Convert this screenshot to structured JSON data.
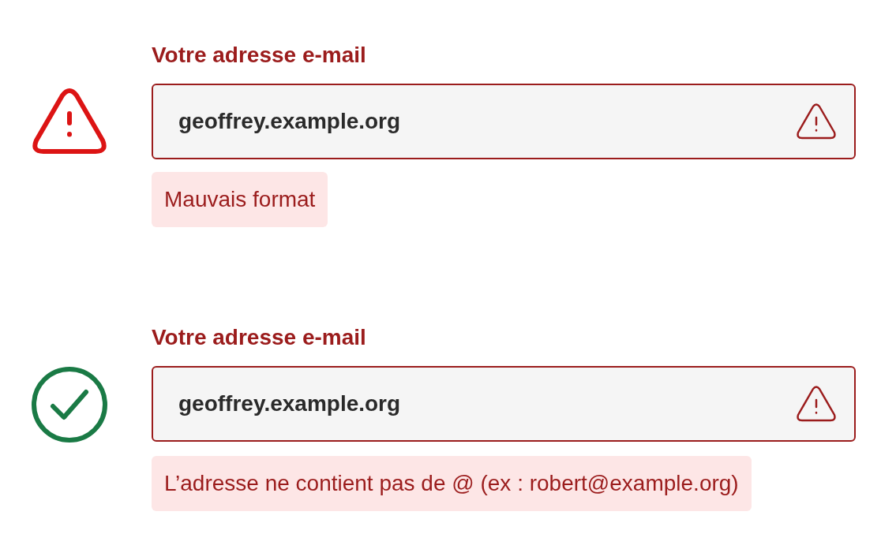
{
  "examples": [
    {
      "kind": "warning",
      "label": "Votre adresse e-mail",
      "value": "geoffrey.example.org",
      "invalid": true,
      "message": "Mauvais format"
    },
    {
      "kind": "check",
      "label": "Votre adresse e-mail",
      "value": "geoffrey.example.org",
      "invalid": true,
      "message": "L’adresse ne contient pas de @ (ex : robert@example.org)"
    }
  ]
}
